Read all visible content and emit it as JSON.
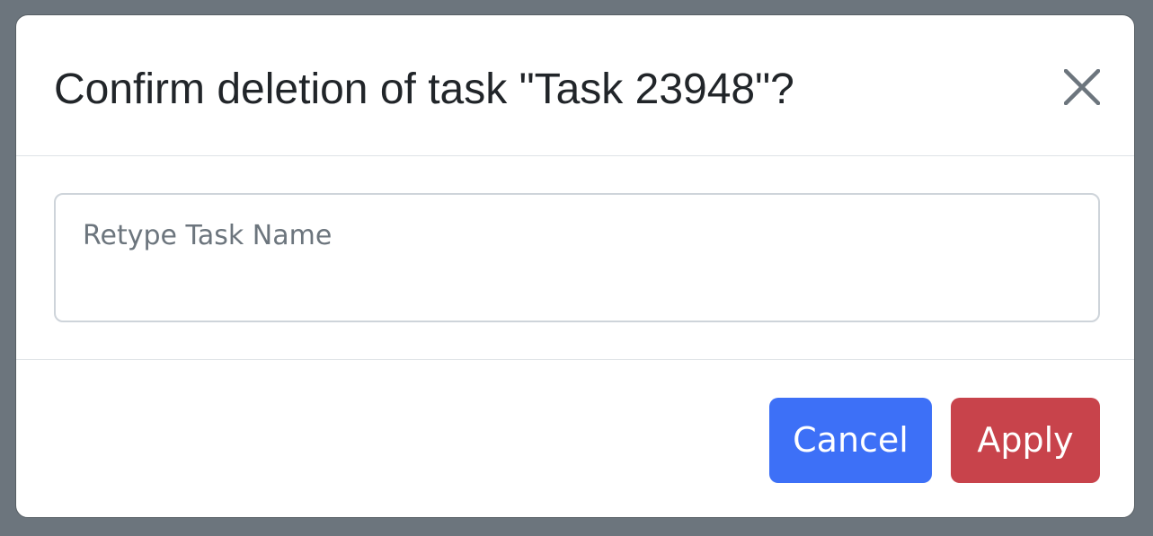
{
  "dialog": {
    "title": "Confirm deletion of task \"Task 23948\"?",
    "close_icon": "close-icon"
  },
  "form": {
    "task_name_value": "",
    "task_name_placeholder": "Retype Task Name"
  },
  "footer": {
    "cancel_label": "Cancel",
    "apply_label": "Apply"
  },
  "colors": {
    "backdrop": "#6c757d",
    "cancel_button": "#3d70f7",
    "apply_button": "#c8434b",
    "title_text": "#212529"
  }
}
